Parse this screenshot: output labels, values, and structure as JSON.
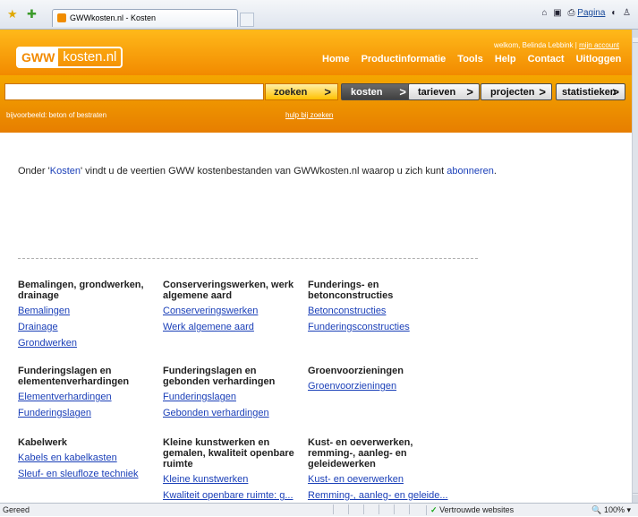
{
  "browser": {
    "tab_title": "GWWkosten.nl - Kosten",
    "cmd_home": "⌂",
    "cmd_feed": "▣",
    "cmd_print": "⎙",
    "cmd_page": "Pagina",
    "cmd_safety": "◐",
    "cmd_tools": "♙",
    "status_text": "Gereed",
    "zone_text": "Vertrouwde websites",
    "zoom_text": "100%"
  },
  "site": {
    "logo_a": "GWW",
    "logo_b": "kosten.nl",
    "welcome_prefix": "welkom, Belinda Lebbink | ",
    "account_link": "mijn account",
    "nav": [
      "Home",
      "Productinformatie",
      "Tools",
      "Help",
      "Contact",
      "Uitloggen"
    ],
    "search_placeholder": "",
    "search_button": "zoeken",
    "cat_kosten": "kosten",
    "cat_tarieven": "tarieven",
    "cat_projecten": "projecten",
    "cat_statistieken": "statistieken",
    "example_text": "bijvoorbeeld: beton of bestraten",
    "help_link": "hulp bij zoeken"
  },
  "intro": {
    "pre": "Onder '",
    "link1": "Kosten",
    "mid": "' vindt u de veertien GWW kostenbestanden van GWWkosten.nl waarop u zich kunt ",
    "link2": "abonneren",
    "post": "."
  },
  "categories": [
    {
      "title": "Bemalingen, grondwerken, drainage",
      "links": [
        "Bemalingen",
        "Drainage",
        "Grondwerken"
      ]
    },
    {
      "title": "Conserveringswerken, werk algemene aard",
      "links": [
        "Conserveringswerken",
        "Werk algemene aard"
      ]
    },
    {
      "title": "Funderings- en betonconstructies",
      "links": [
        "Betonconstructies",
        "Funderingsconstructies"
      ]
    },
    {
      "title": "Funderingslagen en elementenverhardingen",
      "links": [
        "Elementverhardingen",
        "Funderingslagen"
      ]
    },
    {
      "title": "Funderingslagen en gebonden verhardingen",
      "links": [
        "Funderingslagen",
        "Gebonden verhardingen"
      ]
    },
    {
      "title": "Groenvoorzieningen",
      "links": [
        "Groenvoorzieningen"
      ]
    },
    {
      "title": "Kabelwerk",
      "links": [
        "Kabels en kabelkasten",
        "Sleuf- en sleufloze techniek"
      ]
    },
    {
      "title": "Kleine kunstwerken en gemalen, kwaliteit openbare ruimte",
      "links": [
        "Kleine kunstwerken",
        "Kwaliteit openbare ruimte: g..."
      ]
    },
    {
      "title": "Kust- en oeverwerken, remming-, aanleg- en geleidewerken",
      "links": [
        "Kust- en oeverwerken",
        "Remming-, aanleg- en geleide..."
      ]
    }
  ]
}
